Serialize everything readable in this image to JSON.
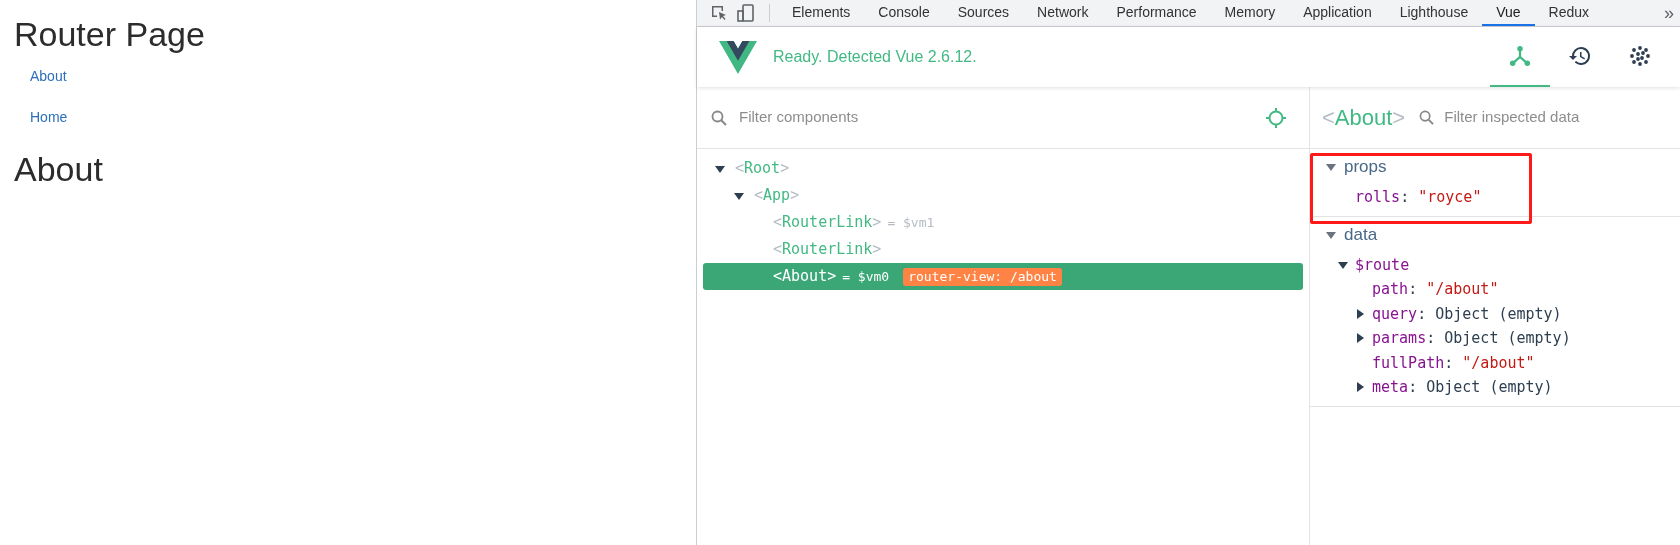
{
  "page": {
    "title": "Router Page",
    "links": [
      "About",
      "Home"
    ],
    "heading": "About"
  },
  "devtools": {
    "tabs": [
      {
        "label": "Elements",
        "selected": false
      },
      {
        "label": "Console",
        "selected": false
      },
      {
        "label": "Sources",
        "selected": false
      },
      {
        "label": "Network",
        "selected": false
      },
      {
        "label": "Performance",
        "selected": false
      },
      {
        "label": "Memory",
        "selected": false
      },
      {
        "label": "Application",
        "selected": false
      },
      {
        "label": "Lighthouse",
        "selected": false
      },
      {
        "label": "Vue",
        "selected": true
      },
      {
        "label": "Redux",
        "selected": false
      }
    ],
    "more": "»"
  },
  "vue": {
    "status": "Ready. Detected Vue 2.6.12.",
    "views": [
      {
        "kind": "components",
        "selected": true
      },
      {
        "kind": "history",
        "selected": false
      },
      {
        "kind": "performance",
        "selected": false
      }
    ]
  },
  "components": {
    "filter_placeholder": "Filter components",
    "brackets": [
      "<",
      ">"
    ],
    "tree": [
      {
        "name": "Root",
        "expanded": true,
        "selected": false,
        "children": [
          {
            "name": "App",
            "expanded": true,
            "selected": false,
            "children": [
              {
                "name": "RouterLink",
                "ref": "= $vm1",
                "selected": false
              },
              {
                "name": "RouterLink",
                "selected": false
              },
              {
                "name": "About",
                "ref": "= $vm0",
                "badge": "router-view: /about",
                "selected": true
              }
            ]
          }
        ]
      }
    ]
  },
  "inspector": {
    "component": "About",
    "brackets": [
      "<",
      ">"
    ],
    "filter_placeholder": "Filter inspected data",
    "separator": ":",
    "sections": [
      {
        "title": "props",
        "expanded": true,
        "highlighted": true,
        "entries": [
          {
            "key": "rolls",
            "kind": "string",
            "value": "\"royce\""
          }
        ]
      },
      {
        "title": "data",
        "expanded": true,
        "highlighted": false,
        "entries": [
          {
            "key": "$route",
            "kind": "object",
            "expanded": true,
            "children": [
              {
                "key": "path",
                "kind": "string",
                "value": "\"/about\""
              },
              {
                "key": "query",
                "kind": "object",
                "expanded": false,
                "value": "Object (empty)"
              },
              {
                "key": "params",
                "kind": "object",
                "expanded": false,
                "value": "Object (empty)"
              },
              {
                "key": "fullPath",
                "kind": "string",
                "value": "\"/about\""
              },
              {
                "key": "meta",
                "kind": "object",
                "expanded": false,
                "value": "Object (empty)"
              }
            ]
          }
        ]
      }
    ]
  }
}
